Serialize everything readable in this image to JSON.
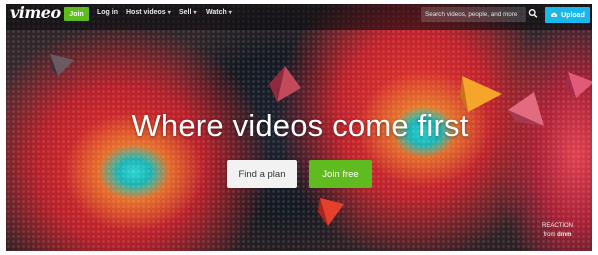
{
  "brand": {
    "logo": "vimeo"
  },
  "nav": {
    "join_label": "Join",
    "links": [
      {
        "label": "Log in",
        "has_dropdown": false
      },
      {
        "label": "Host videos",
        "has_dropdown": true
      },
      {
        "label": "Sell",
        "has_dropdown": true
      },
      {
        "label": "Watch",
        "has_dropdown": true
      }
    ],
    "search_placeholder": "Search videos, people, and more",
    "upload_label": "Upload"
  },
  "hero": {
    "headline": "Where videos come first",
    "find_plan_label": "Find a plan",
    "join_free_label": "Join free",
    "credit_title": "REACTION",
    "credit_from": "from",
    "credit_author": "dmm"
  },
  "colors": {
    "accent_green": "#5fbb1f",
    "accent_blue": "#1ab7ea",
    "nav_bg": "#0a0a0c"
  },
  "icons": {
    "search": "search-icon",
    "upload": "cloud-upload-icon",
    "dropdown": "chevron-down-icon"
  }
}
